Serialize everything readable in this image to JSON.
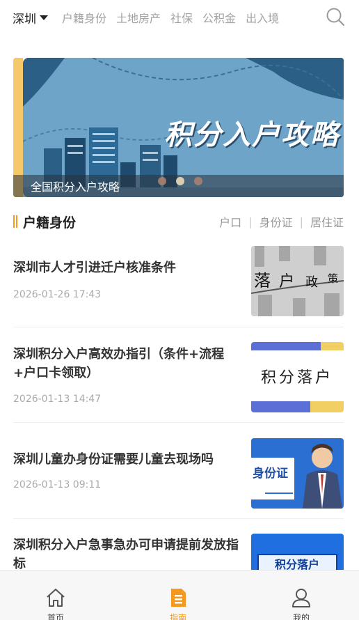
{
  "header": {
    "city": "深圳",
    "tabs": [
      "户籍身份",
      "土地房产",
      "社保",
      "公积金",
      "出入境"
    ]
  },
  "banner": {
    "title": "积分入户攻略",
    "caption": "全国积分入户攻略",
    "slides_total": 3,
    "active_slide": 2
  },
  "section": {
    "title": "户籍身份",
    "links": [
      "户口",
      "身份证",
      "居住证"
    ]
  },
  "articles": [
    {
      "title": "深圳市人才引进迁户核准条件",
      "date": "2026-01-26 17:43",
      "thumb_text": [
        "落",
        "户",
        "政",
        "策"
      ]
    },
    {
      "title": "深圳积分入户高效办指引（条件+流程+户口卡领取）",
      "date": "2026-01-13 14:47",
      "thumb_text": "积分落户"
    },
    {
      "title": "深圳儿童办身份证需要儿童去现场吗",
      "date": "2026-01-13 09:11",
      "thumb_text": "身份证"
    },
    {
      "title": "深圳积分入户急事急办可申请提前发放指标",
      "date": "",
      "thumb_text": "积分落户"
    }
  ],
  "tabbar": [
    {
      "label": "首页",
      "icon": "home-icon",
      "active": false
    },
    {
      "label": "指南",
      "icon": "guide-icon",
      "active": true
    },
    {
      "label": "我的",
      "icon": "profile-icon",
      "active": false
    }
  ],
  "colors": {
    "accent": "#f39a1e",
    "banner_bg": "#6fa4c9"
  }
}
